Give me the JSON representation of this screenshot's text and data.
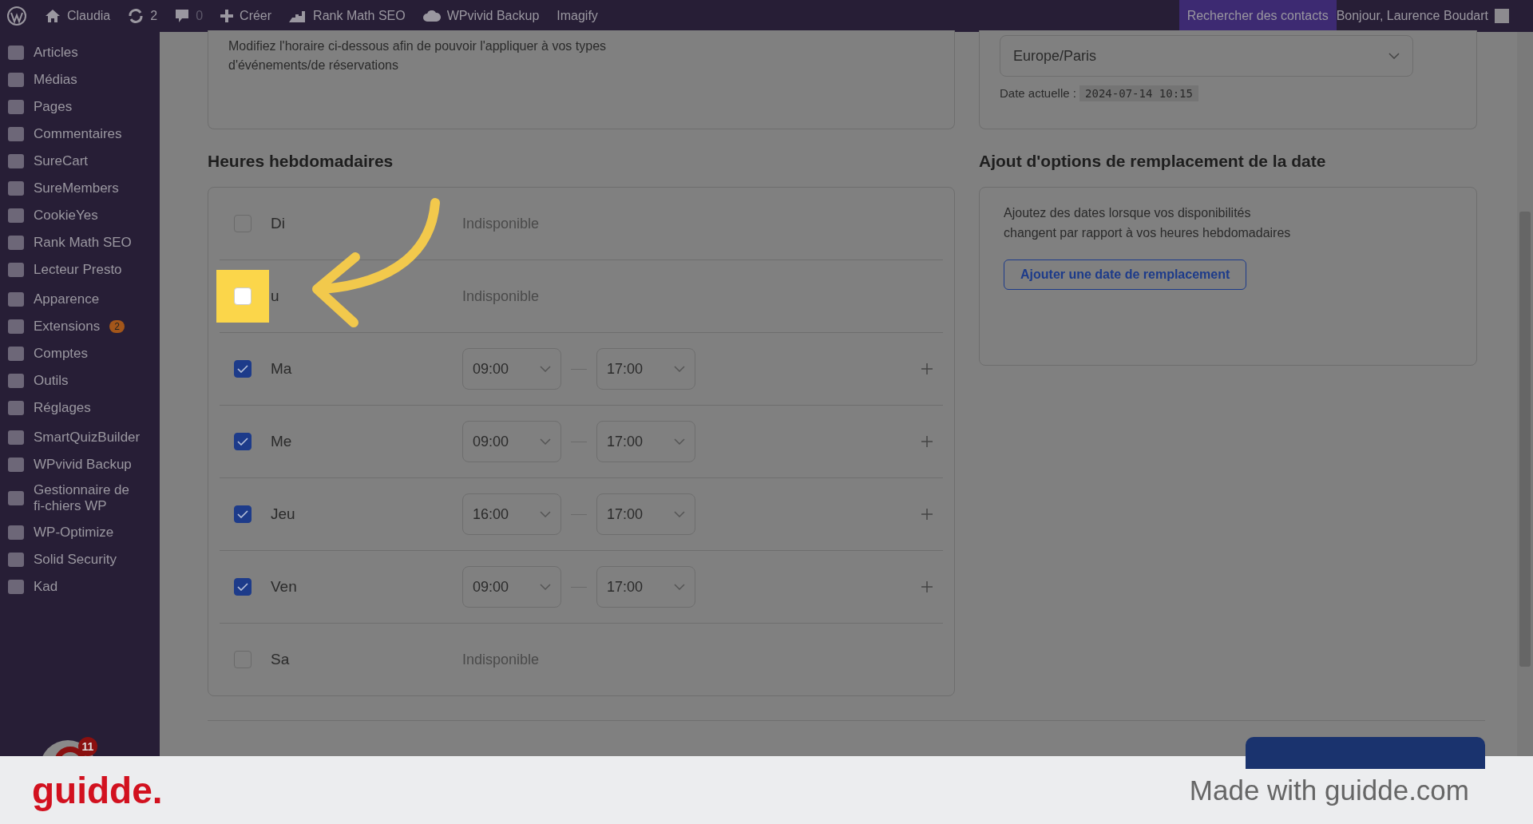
{
  "admin_bar": {
    "items": [
      {
        "kind": "logo"
      },
      {
        "kind": "home",
        "label": "Claudia"
      },
      {
        "kind": "updates",
        "label": "2"
      },
      {
        "kind": "comments",
        "label": "0"
      },
      {
        "kind": "plus",
        "label": "Créer"
      },
      {
        "kind": "chart",
        "label": "Rank Math SEO"
      },
      {
        "kind": "cloud",
        "label": "WPvivid Backup"
      },
      {
        "kind": "text",
        "label": "Imagify"
      }
    ],
    "search": "Rechercher des contacts",
    "greeting": "Bonjour, Laurence Boudart"
  },
  "sidebar": {
    "groups": [
      [
        {
          "label": "Articles"
        },
        {
          "label": "Médias"
        },
        {
          "label": "Pages"
        },
        {
          "label": "Commentaires"
        },
        {
          "label": "SureCart"
        },
        {
          "label": "SureMembers"
        },
        {
          "label": "CookieYes"
        },
        {
          "label": "Rank Math SEO"
        },
        {
          "label": "Lecteur Presto"
        }
      ],
      [
        {
          "label": "Apparence"
        },
        {
          "label": "Extensions",
          "badge": "2"
        },
        {
          "label": "Comptes"
        },
        {
          "label": "Outils"
        },
        {
          "label": "Réglages"
        }
      ],
      [
        {
          "label": "SmartQuizBuilder"
        },
        {
          "label": "WPvivid Backup"
        },
        {
          "label": "Gestionnaire de fi-chiers WP"
        },
        {
          "label": "WP-Optimize"
        },
        {
          "label": "Solid Security"
        },
        {
          "label": "Kad"
        }
      ]
    ],
    "chat_badge": "11"
  },
  "description": "Modifiez l'horaire ci-dessous afin de pouvoir l'appliquer à vos types d'événements/de réservations",
  "timezone": {
    "value": "Europe/Paris",
    "current_label": "Date actuelle :",
    "current_value": "2024-07-14 10:15"
  },
  "weekly": {
    "title": "Heures hebdomadaires",
    "days": [
      {
        "label": "Di",
        "checked": false,
        "highlighted": false,
        "unavailable": "Indisponible"
      },
      {
        "label": "u",
        "checked": false,
        "highlighted": true,
        "unavailable": "Indisponible"
      },
      {
        "label": "Ma",
        "checked": true,
        "highlighted": false,
        "from": "09:00",
        "to": "17:00"
      },
      {
        "label": "Me",
        "checked": true,
        "highlighted": false,
        "from": "09:00",
        "to": "17:00"
      },
      {
        "label": "Jeu",
        "checked": true,
        "highlighted": false,
        "from": "16:00",
        "to": "17:00"
      },
      {
        "label": "Ven",
        "checked": true,
        "highlighted": false,
        "from": "09:00",
        "to": "17:00"
      },
      {
        "label": "Sa",
        "checked": false,
        "highlighted": false,
        "unavailable": "Indisponible"
      }
    ]
  },
  "overrides": {
    "title": "Ajout d'options de remplacement de la date",
    "text": "Ajoutez des dates lorsque vos disponibilités changent par rapport à vos heures hebdomadaires",
    "button": "Ajouter une date de remplacement"
  },
  "footer": {
    "logo": "guidde.",
    "credit": "Made with guidde.com"
  }
}
